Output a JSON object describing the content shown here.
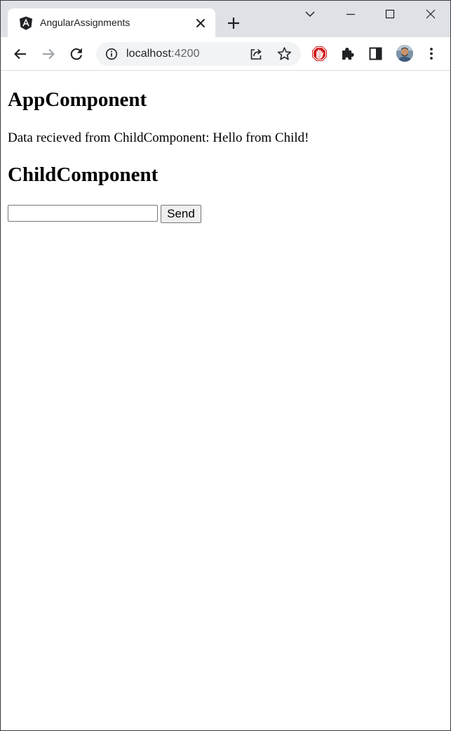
{
  "browser": {
    "tab": {
      "title": "AngularAssignments",
      "favicon": "angular-logo-icon"
    },
    "omnibox": {
      "host": "localhost",
      "port": ":4200",
      "site_info_icon": "info-icon"
    },
    "icons": [
      "back-arrow-icon",
      "forward-arrow-icon",
      "reload-icon",
      "share-icon",
      "star-icon",
      "adblock-stop-icon",
      "puzzle-extensions-icon",
      "side-panel-icon",
      "avatar",
      "kebab-menu-icon"
    ],
    "window_controls": [
      "tab-search-chevron-icon",
      "minimize-icon",
      "maximize-icon",
      "close-window-icon"
    ],
    "colors": {
      "tabstrip": "#dee1e6",
      "omnibox": "#f1f3f4",
      "adblock": "#d01414"
    }
  },
  "page": {
    "app_heading": "AppComponent",
    "data_message": "Data recieved from ChildComponent: Hello from Child!",
    "child_heading": "ChildComponent",
    "input_value": "",
    "send_label": "Send"
  }
}
